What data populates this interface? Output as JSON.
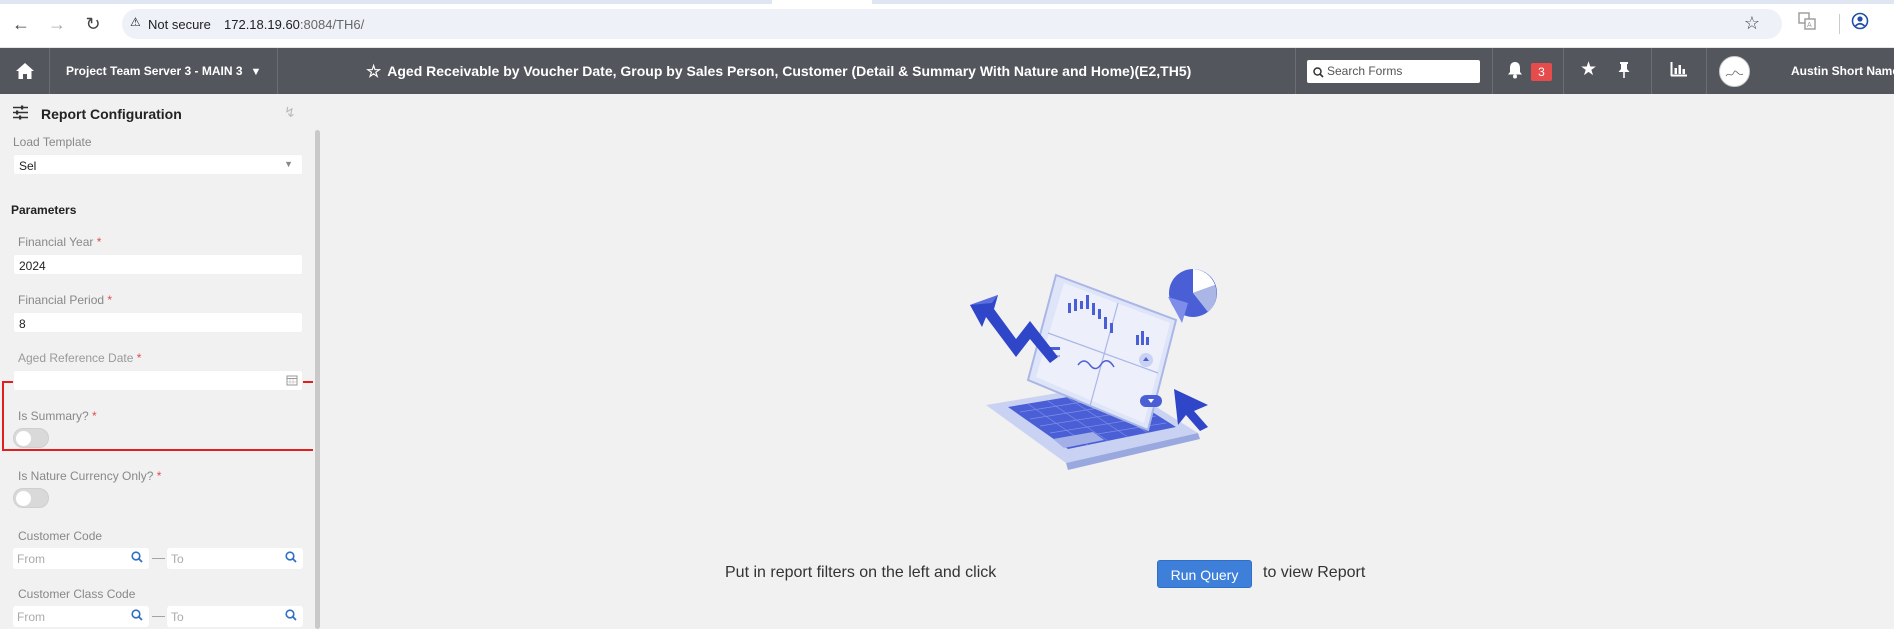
{
  "browser": {
    "security_label": "Not secure",
    "url_host": "172.18.19.60",
    "url_rest": ":8084/TH6/"
  },
  "header": {
    "project_label": "Project Team Server 3 - MAIN 3",
    "report_title": "Aged Receivable by Voucher Date, Group by Sales Person, Customer (Detail & Summary With Nature and Home)(E2,TH5)",
    "search_placeholder": "Search Forms",
    "notification_count": "3",
    "user_name": "Austin Short Name"
  },
  "sidebar": {
    "title": "Report Configuration",
    "load_template_label": "Load Template",
    "load_template_value": "Sel",
    "parameters_heading": "Parameters",
    "fields": {
      "financial_year_label": "Financial Year",
      "financial_year_value": "2024",
      "financial_period_label": "Financial Period",
      "financial_period_value": "8",
      "aged_reference_date_label": "Aged Reference Date",
      "aged_reference_date_value": "",
      "is_summary_label": "Is Summary?",
      "is_summary_value": false,
      "is_nature_currency_label": "Is Nature Currency Only?",
      "is_nature_currency_value": false,
      "customer_code_label": "Customer Code",
      "customer_class_code_label": "Customer Class Code",
      "from_placeholder": "From",
      "to_placeholder": "To",
      "required_mark": "*",
      "range_dash": "—"
    }
  },
  "main": {
    "cta_before": "Put in report filters on the left and click",
    "run_button_label": "Run Query",
    "cta_after": "to view Report"
  },
  "colors": {
    "header_bg": "#54565d",
    "accent": "#3d7fd9",
    "badge": "#e74c4c",
    "highlight": "#e0201e",
    "required": "#e34c4c"
  }
}
